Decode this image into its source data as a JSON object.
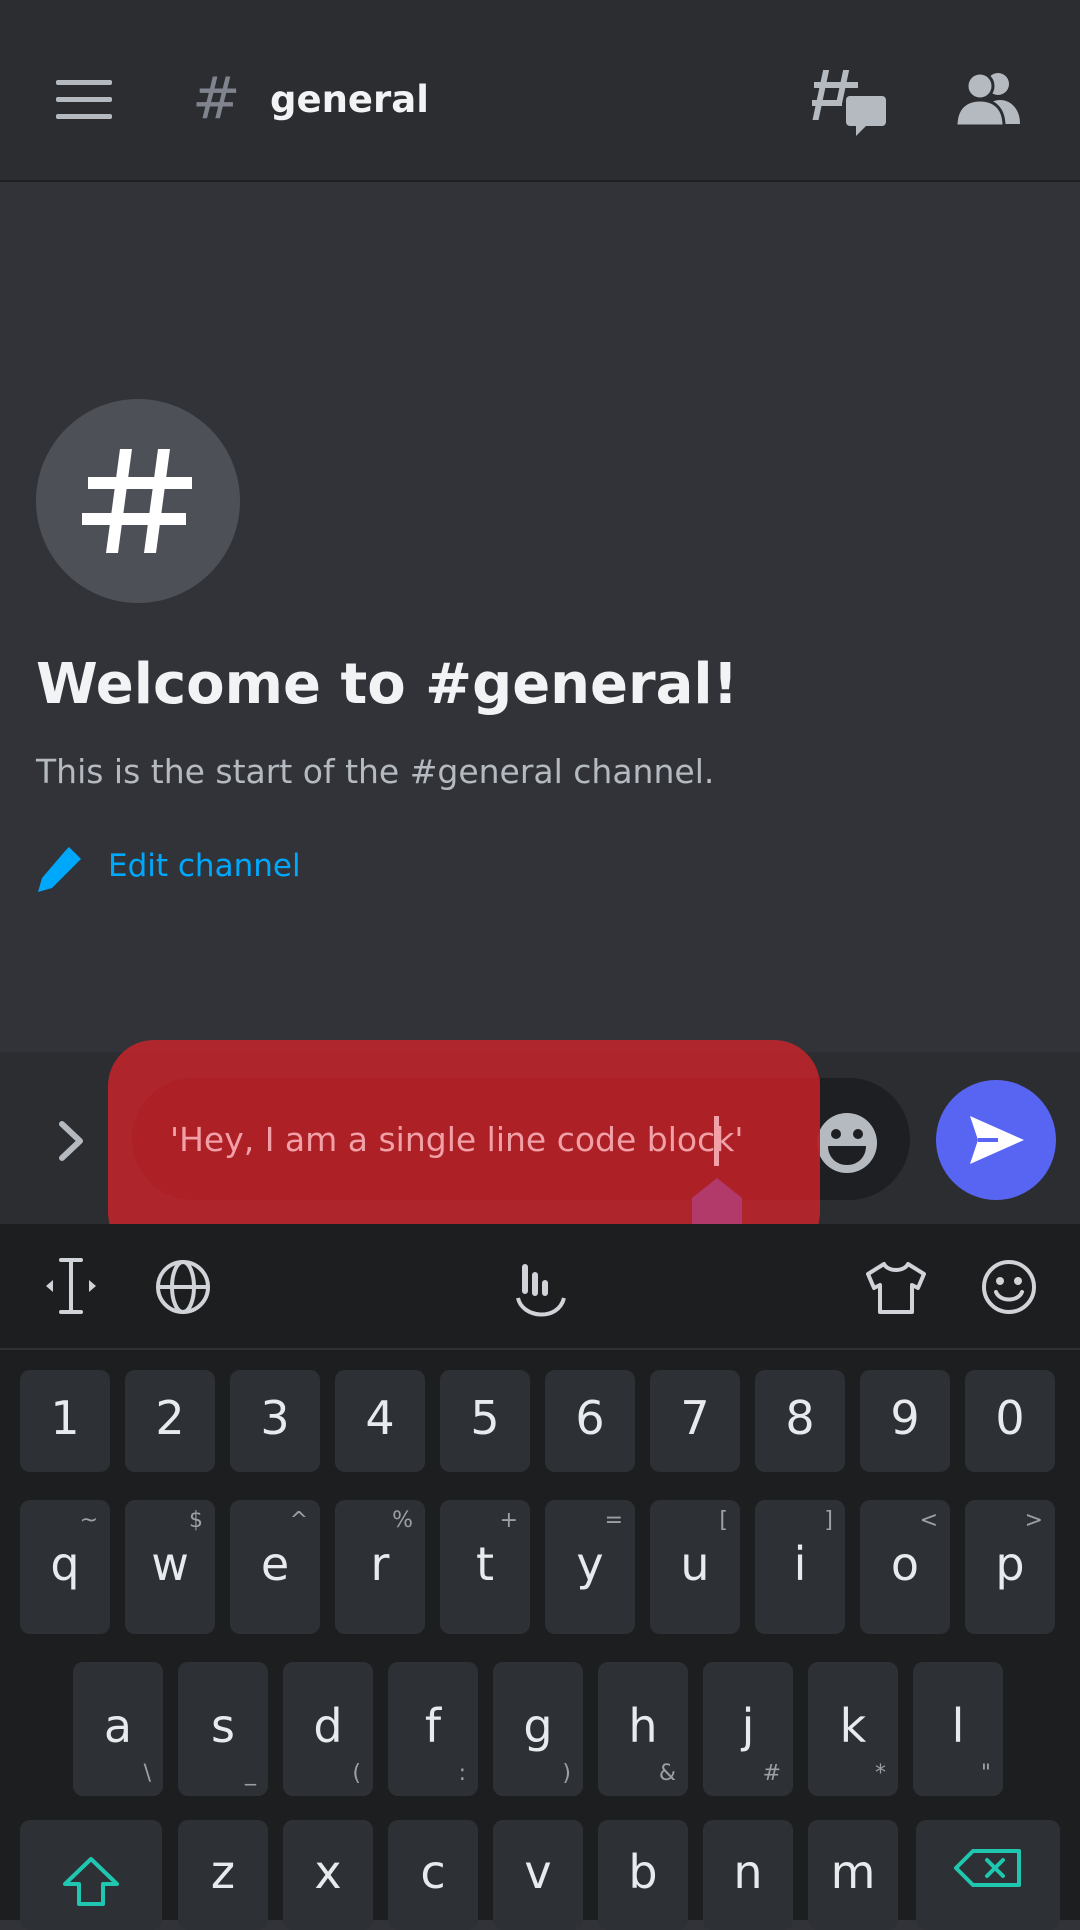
{
  "header": {
    "hash_symbol": "#",
    "channel_name": "general"
  },
  "welcome": {
    "title": "Welcome to #general!",
    "subtitle": "This is the start of the #general channel.",
    "edit_label": "Edit channel"
  },
  "composer": {
    "value": "'Hey, I am a single line code block'"
  },
  "keyboard": {
    "number_row": [
      "1",
      "2",
      "3",
      "4",
      "5",
      "6",
      "7",
      "8",
      "9",
      "0"
    ],
    "row1": [
      {
        "key": "q",
        "alt": "~"
      },
      {
        "key": "w",
        "alt": "$"
      },
      {
        "key": "e",
        "alt": "^"
      },
      {
        "key": "r",
        "alt": "%"
      },
      {
        "key": "t",
        "alt": "+"
      },
      {
        "key": "y",
        "alt": "="
      },
      {
        "key": "u",
        "alt": "["
      },
      {
        "key": "i",
        "alt": "]"
      },
      {
        "key": "o",
        "alt": "<"
      },
      {
        "key": "p",
        "alt": ">"
      }
    ],
    "row2": [
      {
        "key": "a",
        "alt": "\\"
      },
      {
        "key": "s",
        "alt": "_"
      },
      {
        "key": "d",
        "alt": "("
      },
      {
        "key": "f",
        "alt": ":"
      },
      {
        "key": "g",
        "alt": ")"
      },
      {
        "key": "h",
        "alt": "&"
      },
      {
        "key": "j",
        "alt": "#"
      },
      {
        "key": "k",
        "alt": "*"
      },
      {
        "key": "l",
        "alt": "\""
      }
    ],
    "row3": [
      "z",
      "x",
      "c",
      "v",
      "b",
      "n",
      "m"
    ]
  },
  "colors": {
    "background": "#313338",
    "header_bg": "#2b2d31",
    "accent_blue": "#5865f2",
    "link_blue": "#00a8fc",
    "highlight_red": "#c0262a",
    "keyboard_bg": "#1d1e20",
    "key_bg": "#2d3135",
    "shift_teal": "#1fc7b0"
  }
}
